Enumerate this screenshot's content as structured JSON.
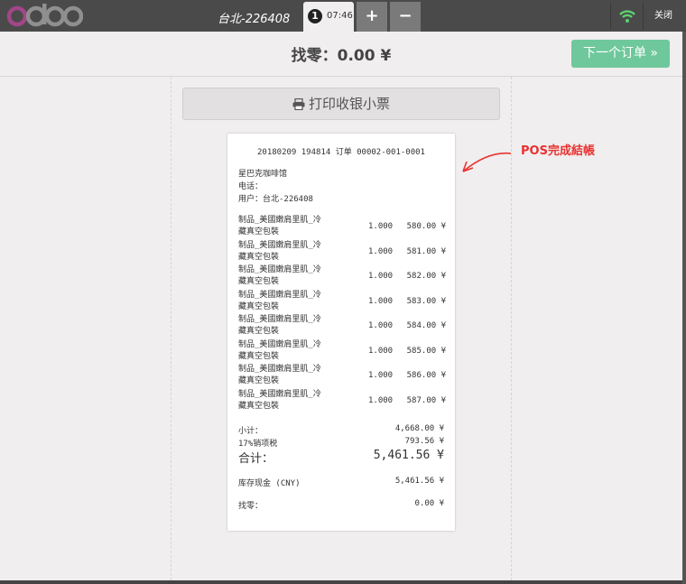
{
  "app": {
    "logo": "odoo",
    "shop_name": "台北-226408",
    "order_tab": {
      "number": "1",
      "time": "07:46"
    },
    "add_tab": "+",
    "remove_tab": "−",
    "close_label": "关闭"
  },
  "header": {
    "change_label": "找零：0.00 ¥",
    "next_order_label": "下一个订单 »"
  },
  "print_button_label": "打印收银小票",
  "annotation_label": "POS完成結帳",
  "colors": {
    "accent": "#6ec89b",
    "annotation": "#e83232",
    "wifi": "#5bd16e"
  },
  "receipt": {
    "header": "20180209 194814 订单 00002-001-0001",
    "shop_name": "星巴克咖啡馆",
    "phone": "电话：",
    "user": "用户：台北-226408",
    "lines": [
      {
        "name1": "制品_美國嫩肩里肌_冷",
        "name2": "藏真空包裝",
        "qty": "1.000",
        "price": "580.00 ¥"
      },
      {
        "name1": "制品_美國嫩肩里肌_冷",
        "name2": "藏真空包裝",
        "qty": "1.000",
        "price": "581.00 ¥"
      },
      {
        "name1": "制品_美國嫩肩里肌_冷",
        "name2": "藏真空包裝",
        "qty": "1.000",
        "price": "582.00 ¥"
      },
      {
        "name1": "制品_美國嫩肩里肌_冷",
        "name2": "藏真空包裝",
        "qty": "1.000",
        "price": "583.00 ¥"
      },
      {
        "name1": "制品_美國嫩肩里肌_冷",
        "name2": "藏真空包裝",
        "qty": "1.000",
        "price": "584.00 ¥"
      },
      {
        "name1": "制品_美國嫩肩里肌_冷",
        "name2": "藏真空包裝",
        "qty": "1.000",
        "price": "585.00 ¥"
      },
      {
        "name1": "制品_美國嫩肩里肌_冷",
        "name2": "藏真空包裝",
        "qty": "1.000",
        "price": "586.00 ¥"
      },
      {
        "name1": "制品_美國嫩肩里肌_冷",
        "name2": "藏真空包裝",
        "qty": "1.000",
        "price": "587.00 ¥"
      }
    ],
    "subtotal_label": "小计：",
    "subtotal_value": "4,668.00 ¥",
    "tax_label": "17%销项税",
    "tax_value": "793.56 ¥",
    "total_label": "合计：",
    "total_value": "5,461.56 ¥",
    "cash_label": "库存现金 (CNY)",
    "cash_value": "5,461.56 ¥",
    "change_label": "找零：",
    "change_value": "0.00 ¥"
  }
}
